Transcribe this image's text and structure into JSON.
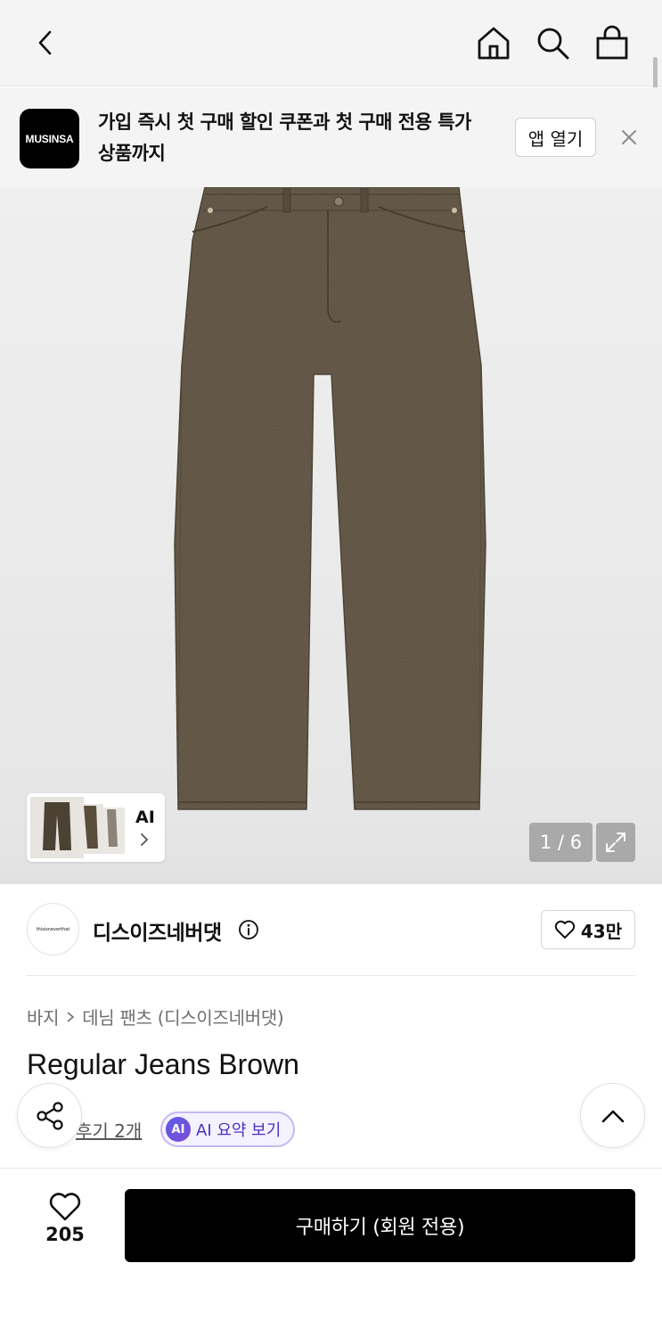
{
  "nav": {
    "back_icon": "chevron-left-icon",
    "home_icon": "home-icon",
    "search_icon": "search-icon",
    "cart_icon": "shopping-bag-icon"
  },
  "banner": {
    "logo_text": "MUSINSA",
    "message": "가입 즉시 첫 구매 할인 쿠폰과 첫 구매 전용 특가 상품까지",
    "open_app_label": "앱 열기",
    "close_icon": "close-icon"
  },
  "gallery": {
    "ai_label": "AI",
    "counter": "1 / 6",
    "current_index": 1,
    "total_images": 6,
    "background_color": "#ececec",
    "product_color": "#5f5444"
  },
  "brand": {
    "logo_text": "thisisneverthat",
    "name": "디스이즈네버댓",
    "follow_count": "43만"
  },
  "product": {
    "breadcrumb": [
      "바지",
      "데님 팬츠 (디스이즈네버댓)"
    ],
    "title": "Regular Jeans Brown",
    "review_label": "후기 2개",
    "ai_summary_badge": "AI",
    "ai_summary_label": "AI 요약 보기"
  },
  "bottom": {
    "like_count": "205",
    "buy_label": "구매하기 (회원 전용)",
    "buy_button_color": "#000000"
  }
}
